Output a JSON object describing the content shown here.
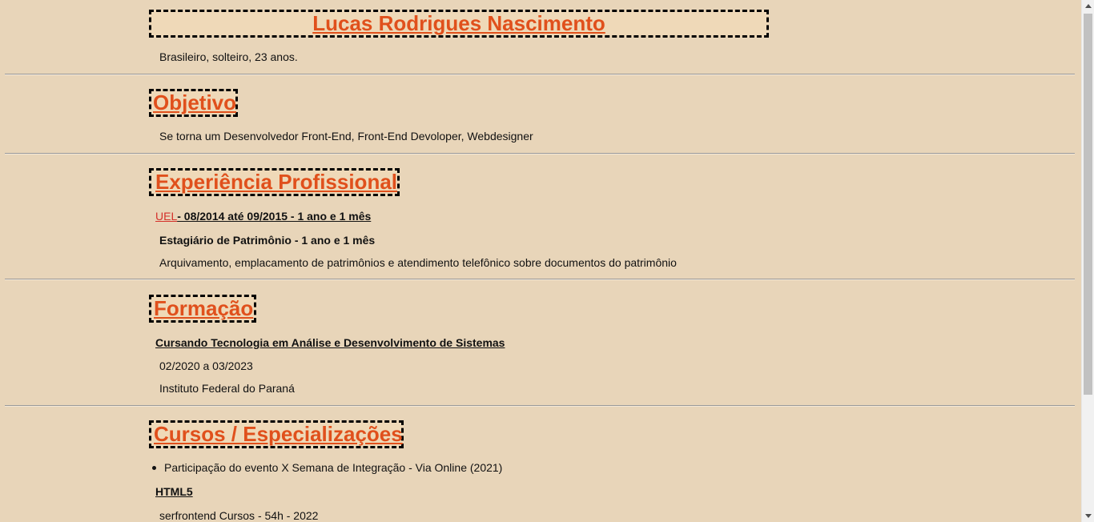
{
  "header": {
    "name": "Lucas Rodrigues Nascimento",
    "info": "Brasileiro, solteiro, 23 anos."
  },
  "objetivo": {
    "title": "Objetivo",
    "text": "Se torna um Desenvolvedor Front-End, Front-End Devoloper, Webdesigner"
  },
  "experiencia": {
    "title": "Experiência Profissional",
    "company_link": "UEL",
    "period": "- 08/2014 até 09/2015 - 1 ano e 1 mês",
    "role": "Estagiário de Patrimônio - 1 ano e 1 mês",
    "description": "Arquivamento, emplacamento de patrimônios e atendimento telefônico sobre documentos do patrimônio"
  },
  "formacao": {
    "title": "Formação",
    "course": "Cursando Tecnologia em Análise e Desenvolvimento de Sistemas",
    "period": "02/2020 a 03/2023",
    "institution": "Instituto Federal do Paraná"
  },
  "cursos": {
    "title": "Cursos / Especializações",
    "items": [
      "Participação do evento X Semana de Integração - Via Online (2021)"
    ],
    "html5_title": "HTML5",
    "html5_desc": "serfrontend Cursos - 54h - 2022"
  }
}
